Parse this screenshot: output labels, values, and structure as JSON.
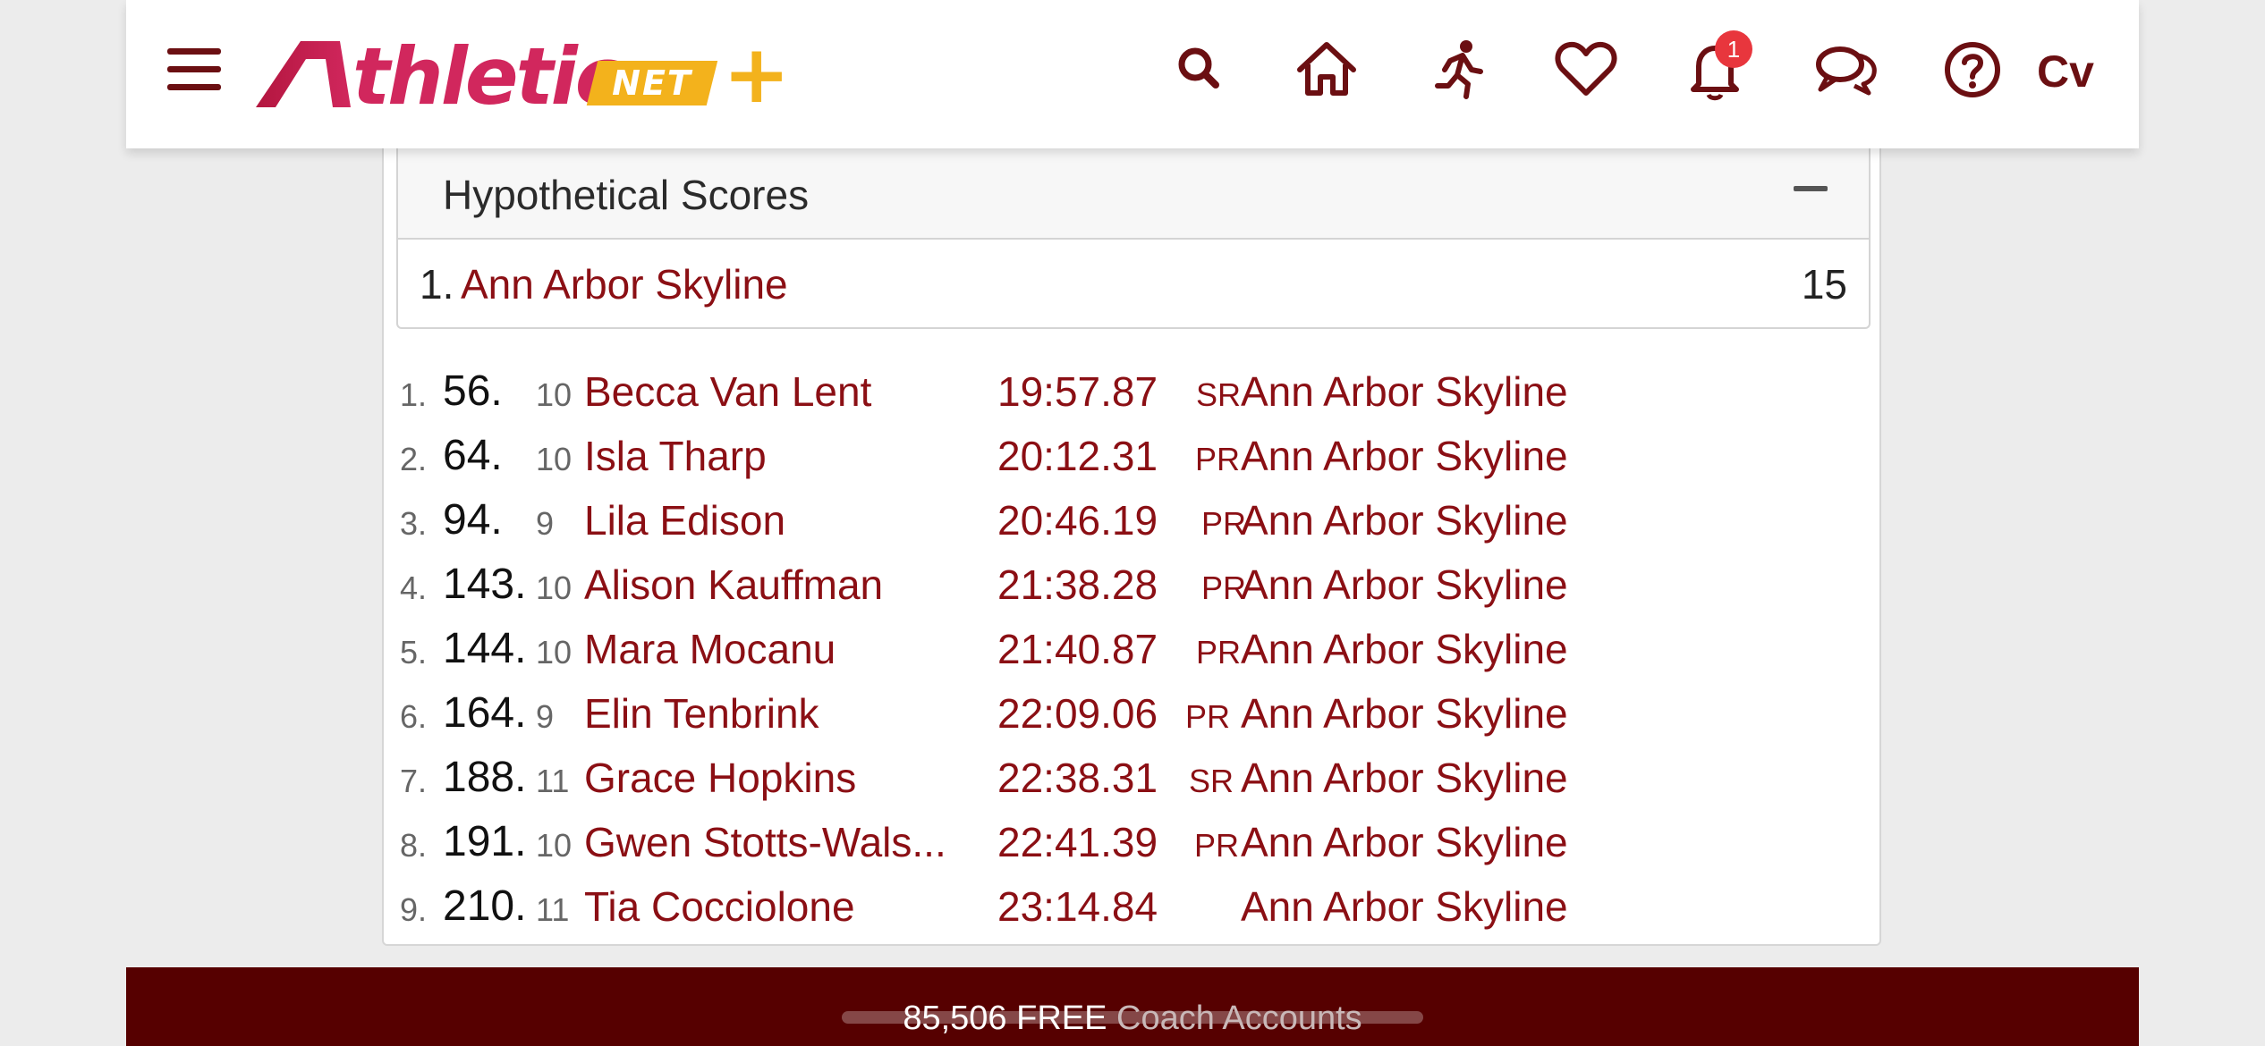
{
  "header": {
    "logo": {
      "main": "thletic",
      "net": "NET",
      "plus": "+"
    },
    "notifications_count": "1",
    "user_initials": "Cv",
    "icons": [
      "menu-icon",
      "search-icon",
      "home-icon",
      "runner-icon",
      "heart-icon",
      "bell-icon",
      "chat-icon",
      "help-icon"
    ]
  },
  "scores": {
    "title": "Hypothetical Scores",
    "rows": [
      {
        "rank": "1.",
        "team": "Ann Arbor Skyline",
        "points": "15"
      }
    ]
  },
  "results": [
    {
      "idx": "1.",
      "place": "56.",
      "grade": "10",
      "name": "Becca Van Lent",
      "time": "19:57.87",
      "tag": "SR",
      "team": "Ann Arbor Skyline"
    },
    {
      "idx": "2.",
      "place": "64.",
      "grade": "10",
      "name": "Isla Tharp",
      "time": "20:12.31",
      "tag": "PR",
      "team": "Ann Arbor Skyline"
    },
    {
      "idx": "3.",
      "place": "94.",
      "grade": "9",
      "name": "Lila Edison",
      "time": "20:46.19",
      "tag": "PR",
      "team": "Ann Arbor Skyline"
    },
    {
      "idx": "4.",
      "place": "143.",
      "grade": "10",
      "name": "Alison Kauffman",
      "time": "21:38.28",
      "tag": "PR",
      "team": "Ann Arbor Skyline"
    },
    {
      "idx": "5.",
      "place": "144.",
      "grade": "10",
      "name": "Mara Mocanu",
      "time": "21:40.87",
      "tag": "PR",
      "team": "Ann Arbor Skyline"
    },
    {
      "idx": "6.",
      "place": "164.",
      "grade": "9",
      "name": "Elin Tenbrink",
      "time": "22:09.06",
      "tag": "PR",
      "team": "Ann Arbor Skyline"
    },
    {
      "idx": "7.",
      "place": "188.",
      "grade": "11",
      "name": "Grace Hopkins",
      "time": "22:38.31",
      "tag": "SR",
      "team": "Ann Arbor Skyline"
    },
    {
      "idx": "8.",
      "place": "191.",
      "grade": "10",
      "name": "Gwen Stotts-Wals...",
      "time": "22:41.39",
      "tag": "PR",
      "team": "Ann Arbor Skyline"
    },
    {
      "idx": "9.",
      "place": "210.",
      "grade": "11",
      "name": "Tia Cocciolone",
      "time": "23:14.84",
      "tag": "",
      "team": "Ann Arbor Skyline"
    }
  ],
  "footer": {
    "count": "85,506",
    "free": "FREE",
    "label": "Coach Accounts"
  },
  "colors": {
    "brand_dark": "#6b0f12",
    "link": "#8b0f14",
    "logo_pink": "#d1275d",
    "logo_gold": "#f3b21c",
    "footer_bg": "#560000",
    "badge": "#e8363d"
  }
}
